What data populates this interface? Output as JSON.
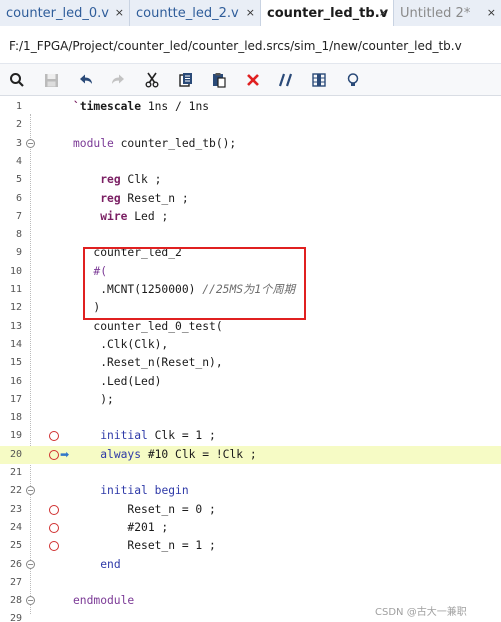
{
  "tabs": [
    {
      "label": "counter_led_0.v",
      "close": "×"
    },
    {
      "label": "countte_led_2.v",
      "close": "×"
    },
    {
      "label": "counter_led_tb.v",
      "close": "×"
    },
    {
      "label": "Untitled 2*",
      "close": "×"
    }
  ],
  "file_path": "F:/1_FPGA/Project/counter_led/counter_led.srcs/sim_1/new/counter_led_tb.v",
  "toolbar_icons": [
    "search-icon",
    "save-icon",
    "undo-icon",
    "redo-icon",
    "cut-icon",
    "copy-icon",
    "paste-icon",
    "delete-icon",
    "comment-icon",
    "column-select-icon",
    "lightbulb-icon"
  ],
  "lines": [
    {
      "n": "1",
      "code": "`timescale 1ns / 1ns"
    },
    {
      "n": "2",
      "code": ""
    },
    {
      "n": "3",
      "code": "module counter_led_tb();"
    },
    {
      "n": "4",
      "code": ""
    },
    {
      "n": "5",
      "code": "reg Clk ;"
    },
    {
      "n": "6",
      "code": "reg Reset_n ;"
    },
    {
      "n": "7",
      "code": "wire Led ;"
    },
    {
      "n": "8",
      "code": ""
    },
    {
      "n": "9",
      "code": "counter_led_2"
    },
    {
      "n": "10",
      "code": "#("
    },
    {
      "n": "11",
      "code": ".MCNT(1250000) //25MS为1个周期"
    },
    {
      "n": "12",
      "code": ")"
    },
    {
      "n": "13",
      "code": "counter_led_0_test("
    },
    {
      "n": "14",
      "code": ".Clk(Clk),"
    },
    {
      "n": "15",
      "code": ".Reset_n(Reset_n),"
    },
    {
      "n": "16",
      "code": ".Led(Led)"
    },
    {
      "n": "17",
      "code": ");"
    },
    {
      "n": "18",
      "code": ""
    },
    {
      "n": "19",
      "code": "initial Clk = 1 ;"
    },
    {
      "n": "20",
      "code": "always #10 Clk = !Clk ;"
    },
    {
      "n": "21",
      "code": ""
    },
    {
      "n": "22",
      "code": "initial begin"
    },
    {
      "n": "23",
      "code": "Reset_n = 0 ;"
    },
    {
      "n": "24",
      "code": "#201 ;"
    },
    {
      "n": "25",
      "code": "Reset_n = 1 ;"
    },
    {
      "n": "26",
      "code": "end"
    },
    {
      "n": "27",
      "code": ""
    },
    {
      "n": "28",
      "code": "endmodule"
    },
    {
      "n": "29",
      "code": ""
    }
  ],
  "watermark": "CSDN @古大一兼职",
  "colors": {
    "keyword": "#7a1f63",
    "blue_keyword": "#2f3aa8",
    "comment": "#6c6c6c",
    "current_line": "#f6fbc5",
    "breakpoint": "#d03030",
    "highlight_box": "#e02020"
  }
}
